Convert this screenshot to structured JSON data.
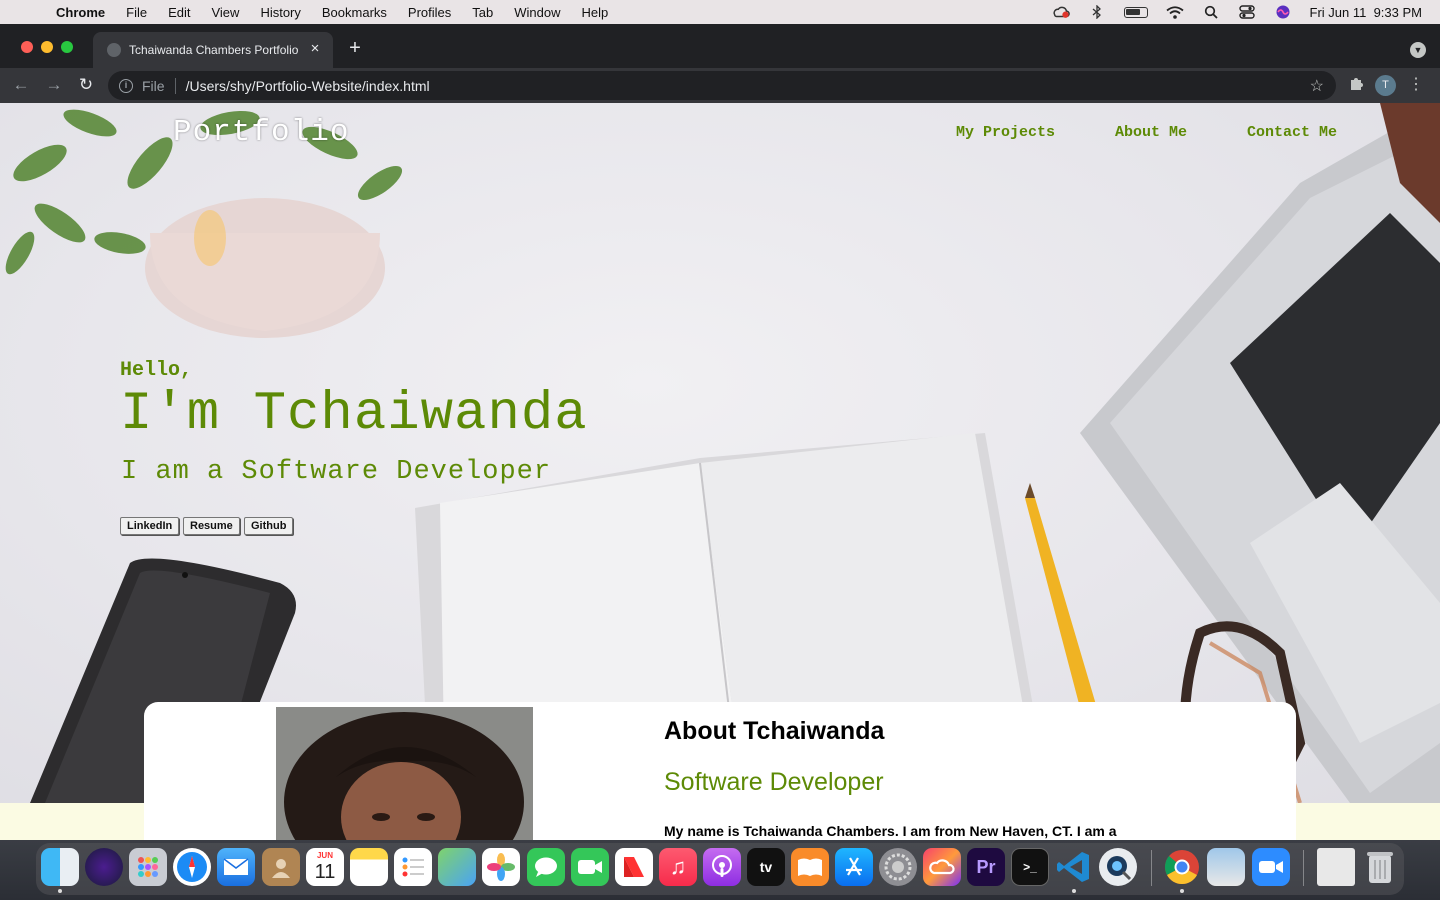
{
  "menubar": {
    "app_name": "Chrome",
    "items": [
      "File",
      "Edit",
      "View",
      "History",
      "Bookmarks",
      "Profiles",
      "Tab",
      "Window",
      "Help"
    ],
    "datetime": "Fri Jun 11  9:33 PM"
  },
  "browser": {
    "tab_title": "Tchaiwanda Chambers Portfolio",
    "scheme_label": "File",
    "url": "/Users/shy/Portfolio-Website/index.html",
    "profile_initial": "T"
  },
  "page": {
    "logo": "Portfolio",
    "nav": [
      "My Projects",
      "About Me",
      "Contact Me"
    ],
    "hello": "Hello,",
    "name": "I'm Tchaiwanda",
    "role": "I am a Software Developer",
    "buttons": [
      "LinkedIn",
      "Resume",
      "Github"
    ],
    "about_title": "About Tchaiwanda",
    "about_subtitle": "Software Developer",
    "about_text": "My name is Tchaiwanda Chambers. I am from New Haven, CT. I am a"
  },
  "dock": {
    "calendar_month": "JUN",
    "calendar_day": "11",
    "tv_label": "tv",
    "premiere_label": "Pr"
  },
  "colors": {
    "accent_green": "#5d8a06",
    "chrome_dark": "#202124"
  }
}
